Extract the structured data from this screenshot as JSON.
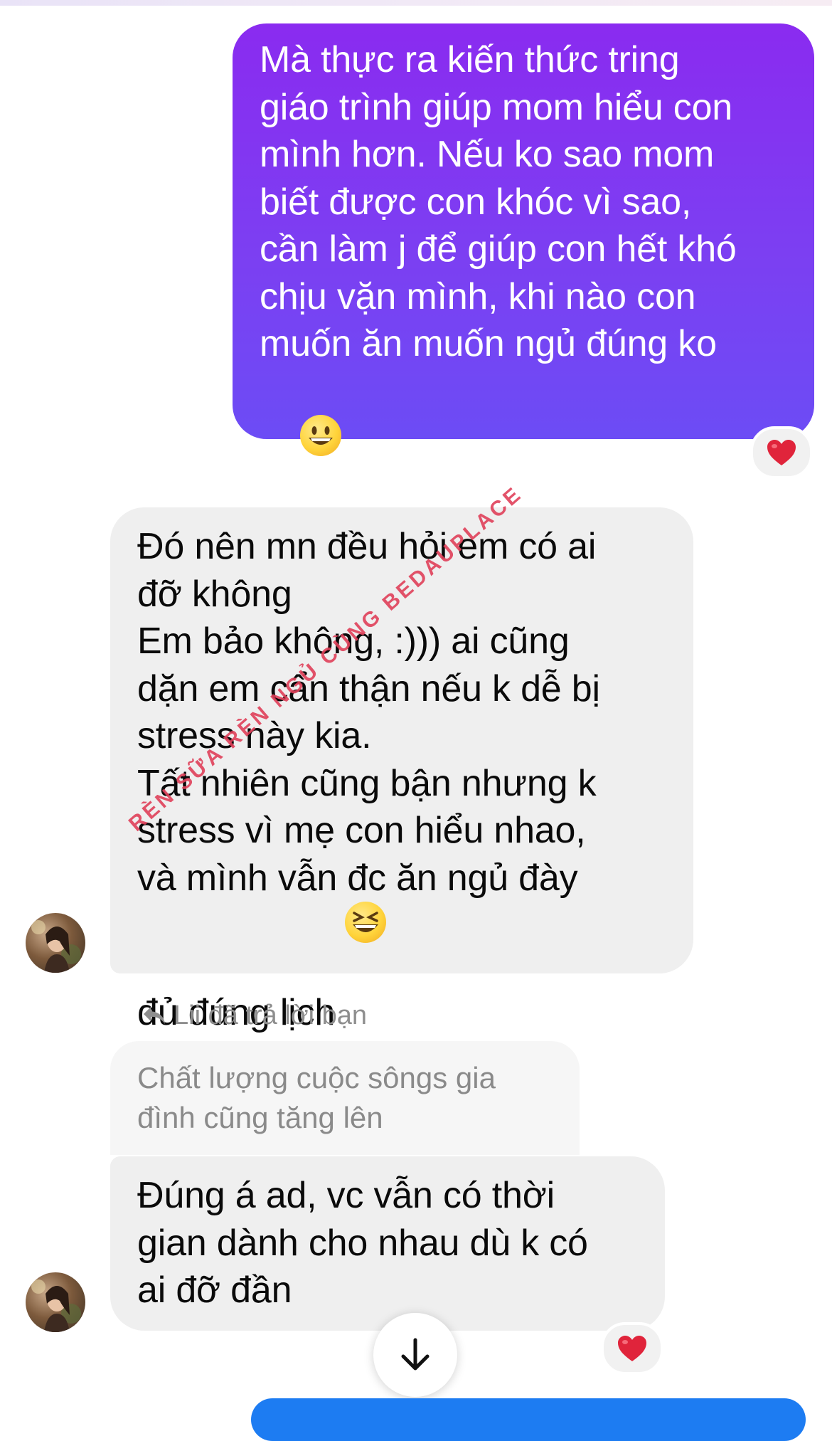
{
  "sent_message": {
    "lines": [
      "Mà thực ra kiến thức tring",
      "giáo trình giúp mom hiểu con",
      "mình hơn. Nếu ko sao mom",
      "biết được con khóc vì sao,",
      "cần làm j để giúp con hết khó",
      "chịu vặn mình, khi nào con",
      "muốn ăn muốn ngủ đúng ko"
    ],
    "emoji": "grinning-face",
    "gradient_colors": [
      "#8a2bf0",
      "#6c4cf5"
    ],
    "reaction": "❤️"
  },
  "received_message_1": {
    "lines": [
      "Đó nên mn đều hỏi em có ai",
      "đỡ không",
      "Em bảo không, :))) ai cũng",
      "dặn em cẩn thận nếu k dễ bị",
      "stress này kia.",
      "Tất nhiên cũng bận nhưng k",
      "stress vì mẹ con hiểu nhao,",
      "và mình vẫn đc ăn ngủ đày",
      "đủ đúng lịch"
    ],
    "emoji": "grinning-squinting-face",
    "bubble_color": "#efefef"
  },
  "reply_indicator": {
    "icon": "reply-arrow-icon",
    "text": "Lii đã trả lời bạn"
  },
  "quoted_message": {
    "lines": [
      "Chất lượng cuộc sôngs gia",
      "đình cũng tăng lên"
    ]
  },
  "received_message_2": {
    "lines": [
      "Đúng á ad, vc vẫn có thời",
      "gian dành cho nhau dù k có",
      "ai đỡ đần"
    ],
    "reaction": "❤️"
  },
  "watermark": {
    "text": "RÈN SỮA RÈN NGỦ CÙNG BEDAUPLACE",
    "color": "#e0415a"
  },
  "scroll_button": {
    "icon": "arrow-down-icon"
  },
  "accent_color": "#1d7cf2"
}
